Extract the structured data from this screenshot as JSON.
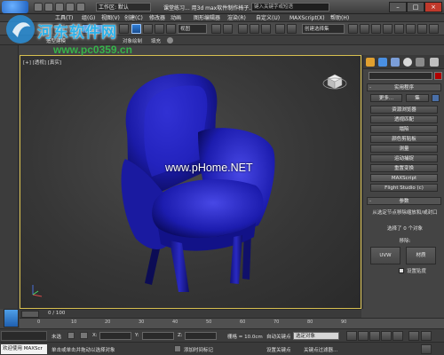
{
  "titlebar": {
    "workspace": "工作区: 默认",
    "document_title": "课堂练习... 用3d max软件制作椅子...",
    "search_placeholder": "键入关键字或短语"
  },
  "menu": {
    "items": [
      "工具(T)",
      "组(G)",
      "视图(V)",
      "创建(C)",
      "修改器",
      "动画",
      "图形编辑器",
      "渲染(R)",
      "自定义(U)",
      "MAXScript(X)",
      "帮助(H)"
    ]
  },
  "toolbar": {
    "view_dropdown": "视图",
    "selection_set": "创建选择集"
  },
  "ribbon": {
    "tabs": [
      "对象绘制",
      "填充"
    ],
    "partial_left": "造型建模"
  },
  "logo": {
    "site_name": "河东软件网",
    "site_url": "www.pc0359.cn"
  },
  "viewport": {
    "label": "[+] [透视] [真实]",
    "watermark": "www.pHome.NET"
  },
  "command_panel": {
    "utilities_title": "实用程序",
    "more_button": "更多...",
    "sets_button": "集",
    "buttons": [
      "资源浏览器",
      "透视匹配",
      "塌陷",
      "颜色剪贴板",
      "测量",
      "运动捕捉",
      "重置变换",
      "MAXScript",
      "Flight Studio (c)"
    ],
    "params_title": "参数",
    "params_text": "从选定节点移除缩放和/或封口",
    "selected_count": "选择了 0 个对象",
    "remove_label": "移除:",
    "uvw_button": "UVW",
    "material_button": "材质",
    "reset_checkbox": "设置贴度"
  },
  "timeline": {
    "frame": "0 / 100",
    "ticks": [
      "0",
      "10",
      "20",
      "30",
      "40",
      "50",
      "60",
      "70",
      "80",
      "90"
    ]
  },
  "status": {
    "none_selected": "未选",
    "x_label": "X:",
    "y_label": "Y:",
    "z_label": "Z:",
    "grid": "栅格 = 10.0cm",
    "auto_key": "自动关键点",
    "selected_objects": "选定对象",
    "set_key": "设置关键点",
    "key_filter": "关键点过滤器...",
    "welcome": "欢迎使用 MAXScr",
    "prompt": "单击或单击并拖动以选择对象",
    "add_time_tag": "添加时间标记"
  },
  "colors": {
    "chair": "#1a1aa8",
    "accent": "#2f7fd8",
    "viewport_border": "#d8c050"
  }
}
